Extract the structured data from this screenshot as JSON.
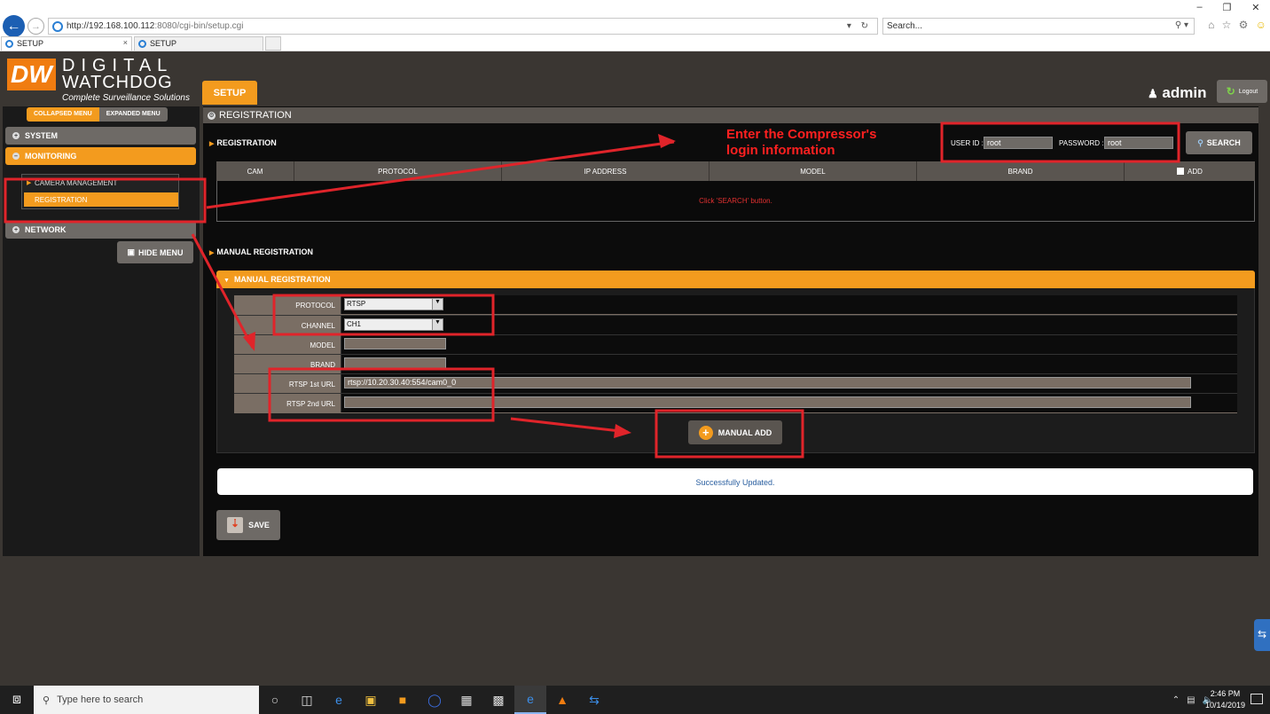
{
  "browser": {
    "url_host": "http://192.168.100.112",
    "url_port_path": ":8080/cgi-bin/setup.cgi",
    "search_placeholder": "Search...",
    "tabs": [
      {
        "label": "SETUP"
      },
      {
        "label": "SETUP"
      }
    ]
  },
  "header": {
    "logo_dw": "DW",
    "logo_line1": "DIGITAL",
    "logo_line2": "WATCHDOG",
    "logo_tagline": "Complete Surveillance Solutions",
    "setup_tab": "SETUP",
    "user": "admin",
    "logout": "Logout"
  },
  "sidebar": {
    "collapsed_menu": "COLLAPSED MENU",
    "expanded_menu": "EXPANDED MENU",
    "system": "SYSTEM",
    "monitoring": "MONITORING",
    "camera_management": "CAMERA MANAGEMENT",
    "registration": "REGISTRATION",
    "network": "NETWORK",
    "hide_menu": "HIDE MENU"
  },
  "main": {
    "page_title": "REGISTRATION",
    "registration_title": "REGISTRATION",
    "user_id_label": "USER ID :",
    "user_id_value": "root",
    "password_label": "PASSWORD :",
    "password_value": "root",
    "search_button": "SEARCH",
    "columns": [
      "CAM",
      "PROTOCOL",
      "IP ADDRESS",
      "MODEL",
      "BRAND",
      "ADD"
    ],
    "empty_message": "Click 'SEARCH' button.",
    "manual_section_title": "MANUAL REGISTRATION",
    "manual_bar_title": "MANUAL REGISTRATION",
    "form": {
      "protocol_label": "PROTOCOL",
      "protocol_value": "RTSP",
      "channel_label": "CHANNEL",
      "channel_value": "CH1",
      "model_label": "MODEL",
      "model_value": "",
      "brand_label": "BRAND",
      "brand_value": "",
      "rtsp1_label": "RTSP 1st URL",
      "rtsp1_value": "rtsp://10.20.30.40:554/cam0_0",
      "rtsp2_label": "RTSP 2nd URL",
      "rtsp2_value": ""
    },
    "manual_add_button": "MANUAL ADD",
    "status_message": "Successfully Updated.",
    "save_button": "SAVE"
  },
  "annotation": {
    "note_line1": "Enter the Compressor's",
    "note_line2": "login information",
    "color": "#e0242a"
  },
  "taskbar": {
    "search_placeholder": "Type here to search",
    "time": "2:46 PM",
    "date": "10/14/2019"
  },
  "colors": {
    "accent_orange": "#f39b1e",
    "panel_gray": "#6e6a66",
    "background": "#3a3632"
  }
}
